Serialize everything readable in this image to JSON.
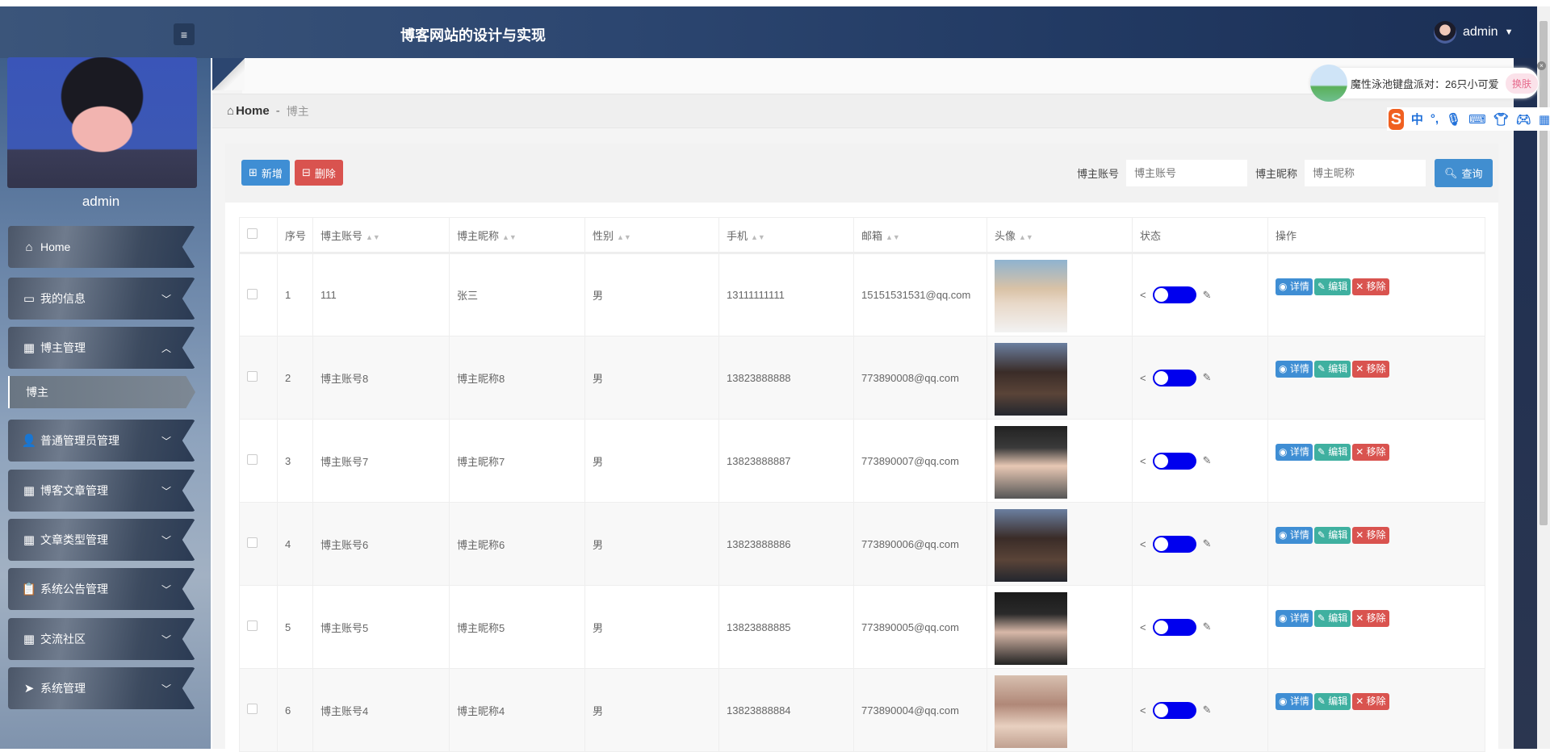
{
  "header": {
    "title": "博客网站的设计与实现",
    "user": "admin"
  },
  "sidebar": {
    "profile_name": "admin",
    "items": [
      {
        "label": "Home",
        "icon": "home-icon",
        "glyph": "⌂",
        "chev": ""
      },
      {
        "label": "我的信息",
        "icon": "card-icon",
        "glyph": "▭",
        "chev": "﹀"
      },
      {
        "label": "博主管理",
        "icon": "grid-icon",
        "glyph": "▦",
        "chev": "︿"
      },
      {
        "label": "普通管理员管理",
        "icon": "user-icon",
        "glyph": "👤",
        "chev": "﹀"
      },
      {
        "label": "博客文章管理",
        "icon": "grid-icon",
        "glyph": "▦",
        "chev": "﹀"
      },
      {
        "label": "文章类型管理",
        "icon": "grid-icon",
        "glyph": "▦",
        "chev": "﹀"
      },
      {
        "label": "系统公告管理",
        "icon": "clipboard-icon",
        "glyph": "📋",
        "chev": "﹀"
      },
      {
        "label": "交流社区",
        "icon": "grid-icon",
        "glyph": "▦",
        "chev": "﹀"
      },
      {
        "label": "系统管理",
        "icon": "send-icon",
        "glyph": "➤",
        "chev": "﹀"
      }
    ],
    "sub_item": "博主"
  },
  "breadcrumb": {
    "home": "Home",
    "sep": "-",
    "current": "博主"
  },
  "toolbar": {
    "add": "新增",
    "delete": "删除",
    "account_label": "博主账号",
    "account_placeholder": "博主账号",
    "nickname_label": "博主昵称",
    "nickname_placeholder": "博主昵称",
    "search": "查询"
  },
  "table": {
    "headers": [
      "序号",
      "博主账号",
      "博主昵称",
      "性别",
      "手机",
      "邮箱",
      "头像",
      "状态",
      "操作"
    ],
    "actions": {
      "detail": "详情",
      "edit": "编辑",
      "remove": "移除"
    },
    "rows": [
      {
        "no": "1",
        "account": "111",
        "nickname": "张三",
        "gender": "男",
        "phone": "13111111111",
        "email": "15151531531@qq.com",
        "enabled": true
      },
      {
        "no": "2",
        "account": "博主账号8",
        "nickname": "博主昵称8",
        "gender": "男",
        "phone": "13823888888",
        "email": "773890008@qq.com",
        "enabled": true
      },
      {
        "no": "3",
        "account": "博主账号7",
        "nickname": "博主昵称7",
        "gender": "男",
        "phone": "13823888887",
        "email": "773890007@qq.com",
        "enabled": true
      },
      {
        "no": "4",
        "account": "博主账号6",
        "nickname": "博主昵称6",
        "gender": "男",
        "phone": "13823888886",
        "email": "773890006@qq.com",
        "enabled": true
      },
      {
        "no": "5",
        "account": "博主账号5",
        "nickname": "博主昵称5",
        "gender": "男",
        "phone": "13823888885",
        "email": "773890005@qq.com",
        "enabled": true
      },
      {
        "no": "6",
        "account": "博主账号4",
        "nickname": "博主昵称4",
        "gender": "男",
        "phone": "13823888884",
        "email": "773890004@qq.com",
        "enabled": true
      }
    ]
  },
  "overlay": {
    "skin_text": "魔性泳池键盘派对：26只小可爱",
    "skin_button": "换肤",
    "ime_mode": "中"
  }
}
